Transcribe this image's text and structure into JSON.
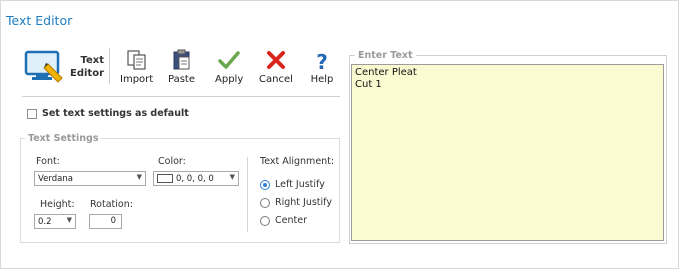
{
  "window": {
    "title": "Text Editor"
  },
  "toolbar": {
    "title_line1": "Text",
    "title_line2": "Editor",
    "import_label": "Import",
    "paste_label": "Paste",
    "apply_label": "Apply",
    "cancel_label": "Cancel",
    "help_label": "Help"
  },
  "default_checkbox": {
    "label": "Set text settings as default",
    "checked": false
  },
  "text_settings": {
    "legend": "Text Settings",
    "font_label": "Font:",
    "font_value": "Verdana",
    "color_label": "Color:",
    "color_value": "0, 0, 0, 0",
    "height_label": "Height:",
    "height_value": "0.2",
    "rotation_label": "Rotation:",
    "rotation_value": "0",
    "alignment_label": "Text Alignment:",
    "alignment_options": [
      "Left Justify",
      "Right Justify",
      "Center"
    ],
    "alignment_selected": "Left Justify"
  },
  "enter_text": {
    "legend": "Enter Text",
    "lines": [
      "Center Pleat",
      "Cut 1"
    ]
  },
  "colors": {
    "accent": "#1f7ec2",
    "text_area_bg": "#fcfad1",
    "apply_green": "#6aa84f",
    "cancel_red": "#d9251c"
  }
}
